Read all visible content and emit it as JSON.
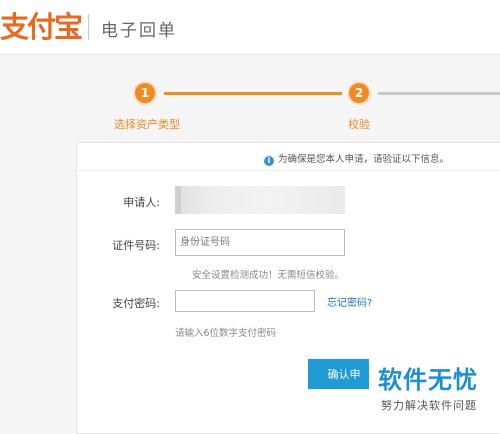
{
  "header": {
    "logo_text": "支付宝",
    "title": "电子回单"
  },
  "steps": [
    {
      "number": "1",
      "label": "选择资产类型"
    },
    {
      "number": "2",
      "label": "校验"
    }
  ],
  "colors": {
    "accent_orange": "#f08a24",
    "button_blue": "#1e9bd4",
    "link_blue": "#1a73c4"
  },
  "form": {
    "notice": "为确保是您本人申请，请验证以下信息。",
    "applicant_label": "申请人:",
    "id_label": "证件号码:",
    "id_placeholder": "身份证号码",
    "security_hint": "安全设置检测成功！无需短信校验。",
    "password_label": "支付密码:",
    "password_value": "",
    "forgot_password": "忘记密码?",
    "password_hint": "请输入6位数字支付密码",
    "confirm_button": "确认申"
  },
  "watermark": {
    "title": "软件无忧",
    "subtitle": "努力解决软件问题"
  }
}
